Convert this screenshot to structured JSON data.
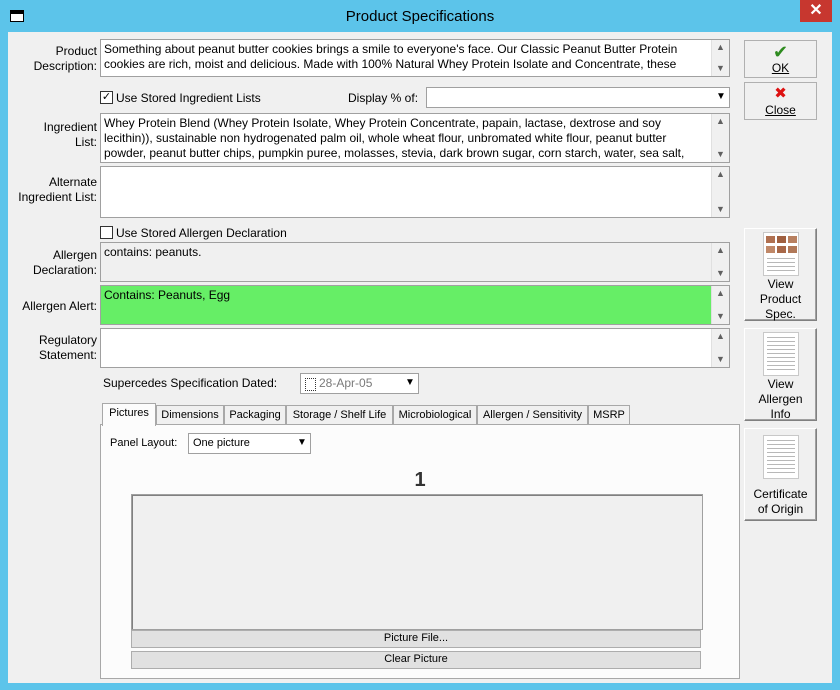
{
  "window": {
    "title": "Product Specifications",
    "close_glyph": "✕"
  },
  "fields": {
    "product_description": {
      "label": "Product\nDescription:",
      "value": "Something about peanut butter cookies brings a smile to everyone's face. Our Classic Peanut Butter Protein cookies are rich, moist and delicious. Made with 100% Natural Whey Protein Isolate and Concentrate, these"
    },
    "use_stored_ingredient": {
      "label": "Use Stored Ingredient Lists",
      "checked": true,
      "mark": "✓"
    },
    "display_pct": {
      "label": "Display % of:",
      "value": ""
    },
    "ingredient_list": {
      "label": "Ingredient\nList:",
      "value": "Whey Protein Blend (Whey Protein Isolate, Whey Protein Concentrate, papain, lactase, dextrose and soy lecithin)), sustainable non hydrogenated palm oil, whole wheat flour, unbromated white flour, peanut butter powder, peanut butter chips, pumpkin puree, molasses, stevia, dark brown sugar, corn starch, water, sea salt,"
    },
    "alternate_ingredient_list": {
      "label": "Alternate\nIngredient List:",
      "value": ""
    },
    "use_stored_allergen": {
      "label": "Use Stored Allergen Declaration",
      "checked": false,
      "mark": ""
    },
    "allergen_declaration": {
      "label": "Allergen\nDeclaration:",
      "value": "contains: peanuts."
    },
    "allergen_alert": {
      "label": "Allergen Alert:",
      "value": "Contains: Peanuts, Egg",
      "color": "#66ee66"
    },
    "regulatory_statement": {
      "label": "Regulatory\nStatement:",
      "value": ""
    },
    "supersedes": {
      "label": "Supercedes Specification Dated:",
      "value": "28-Apr-05"
    }
  },
  "side_buttons": {
    "ok": {
      "label": "OK",
      "icon": "✔"
    },
    "close": {
      "label": "Close",
      "icon": "✖"
    },
    "view_product_spec": {
      "label": "View\nProduct\nSpec."
    },
    "view_allergen_info": {
      "label": "View\nAllergen\nInfo"
    },
    "certificate_of_origin": {
      "label": "Certificate\nof Origin"
    }
  },
  "tabs": [
    "Pictures",
    "Dimensions",
    "Packaging",
    "Storage / Shelf Life",
    "Microbiological",
    "Allergen / Sensitivity",
    "MSRP"
  ],
  "pictures_panel": {
    "panel_layout_label": "Panel Layout:",
    "panel_layout_value": "One picture",
    "picture_number": "1",
    "picture_file_button": "Picture File...",
    "clear_picture_button": "Clear Picture"
  },
  "scroll_glyphs": {
    "up": "▲",
    "down": "▼",
    "dropdown": "▼"
  }
}
